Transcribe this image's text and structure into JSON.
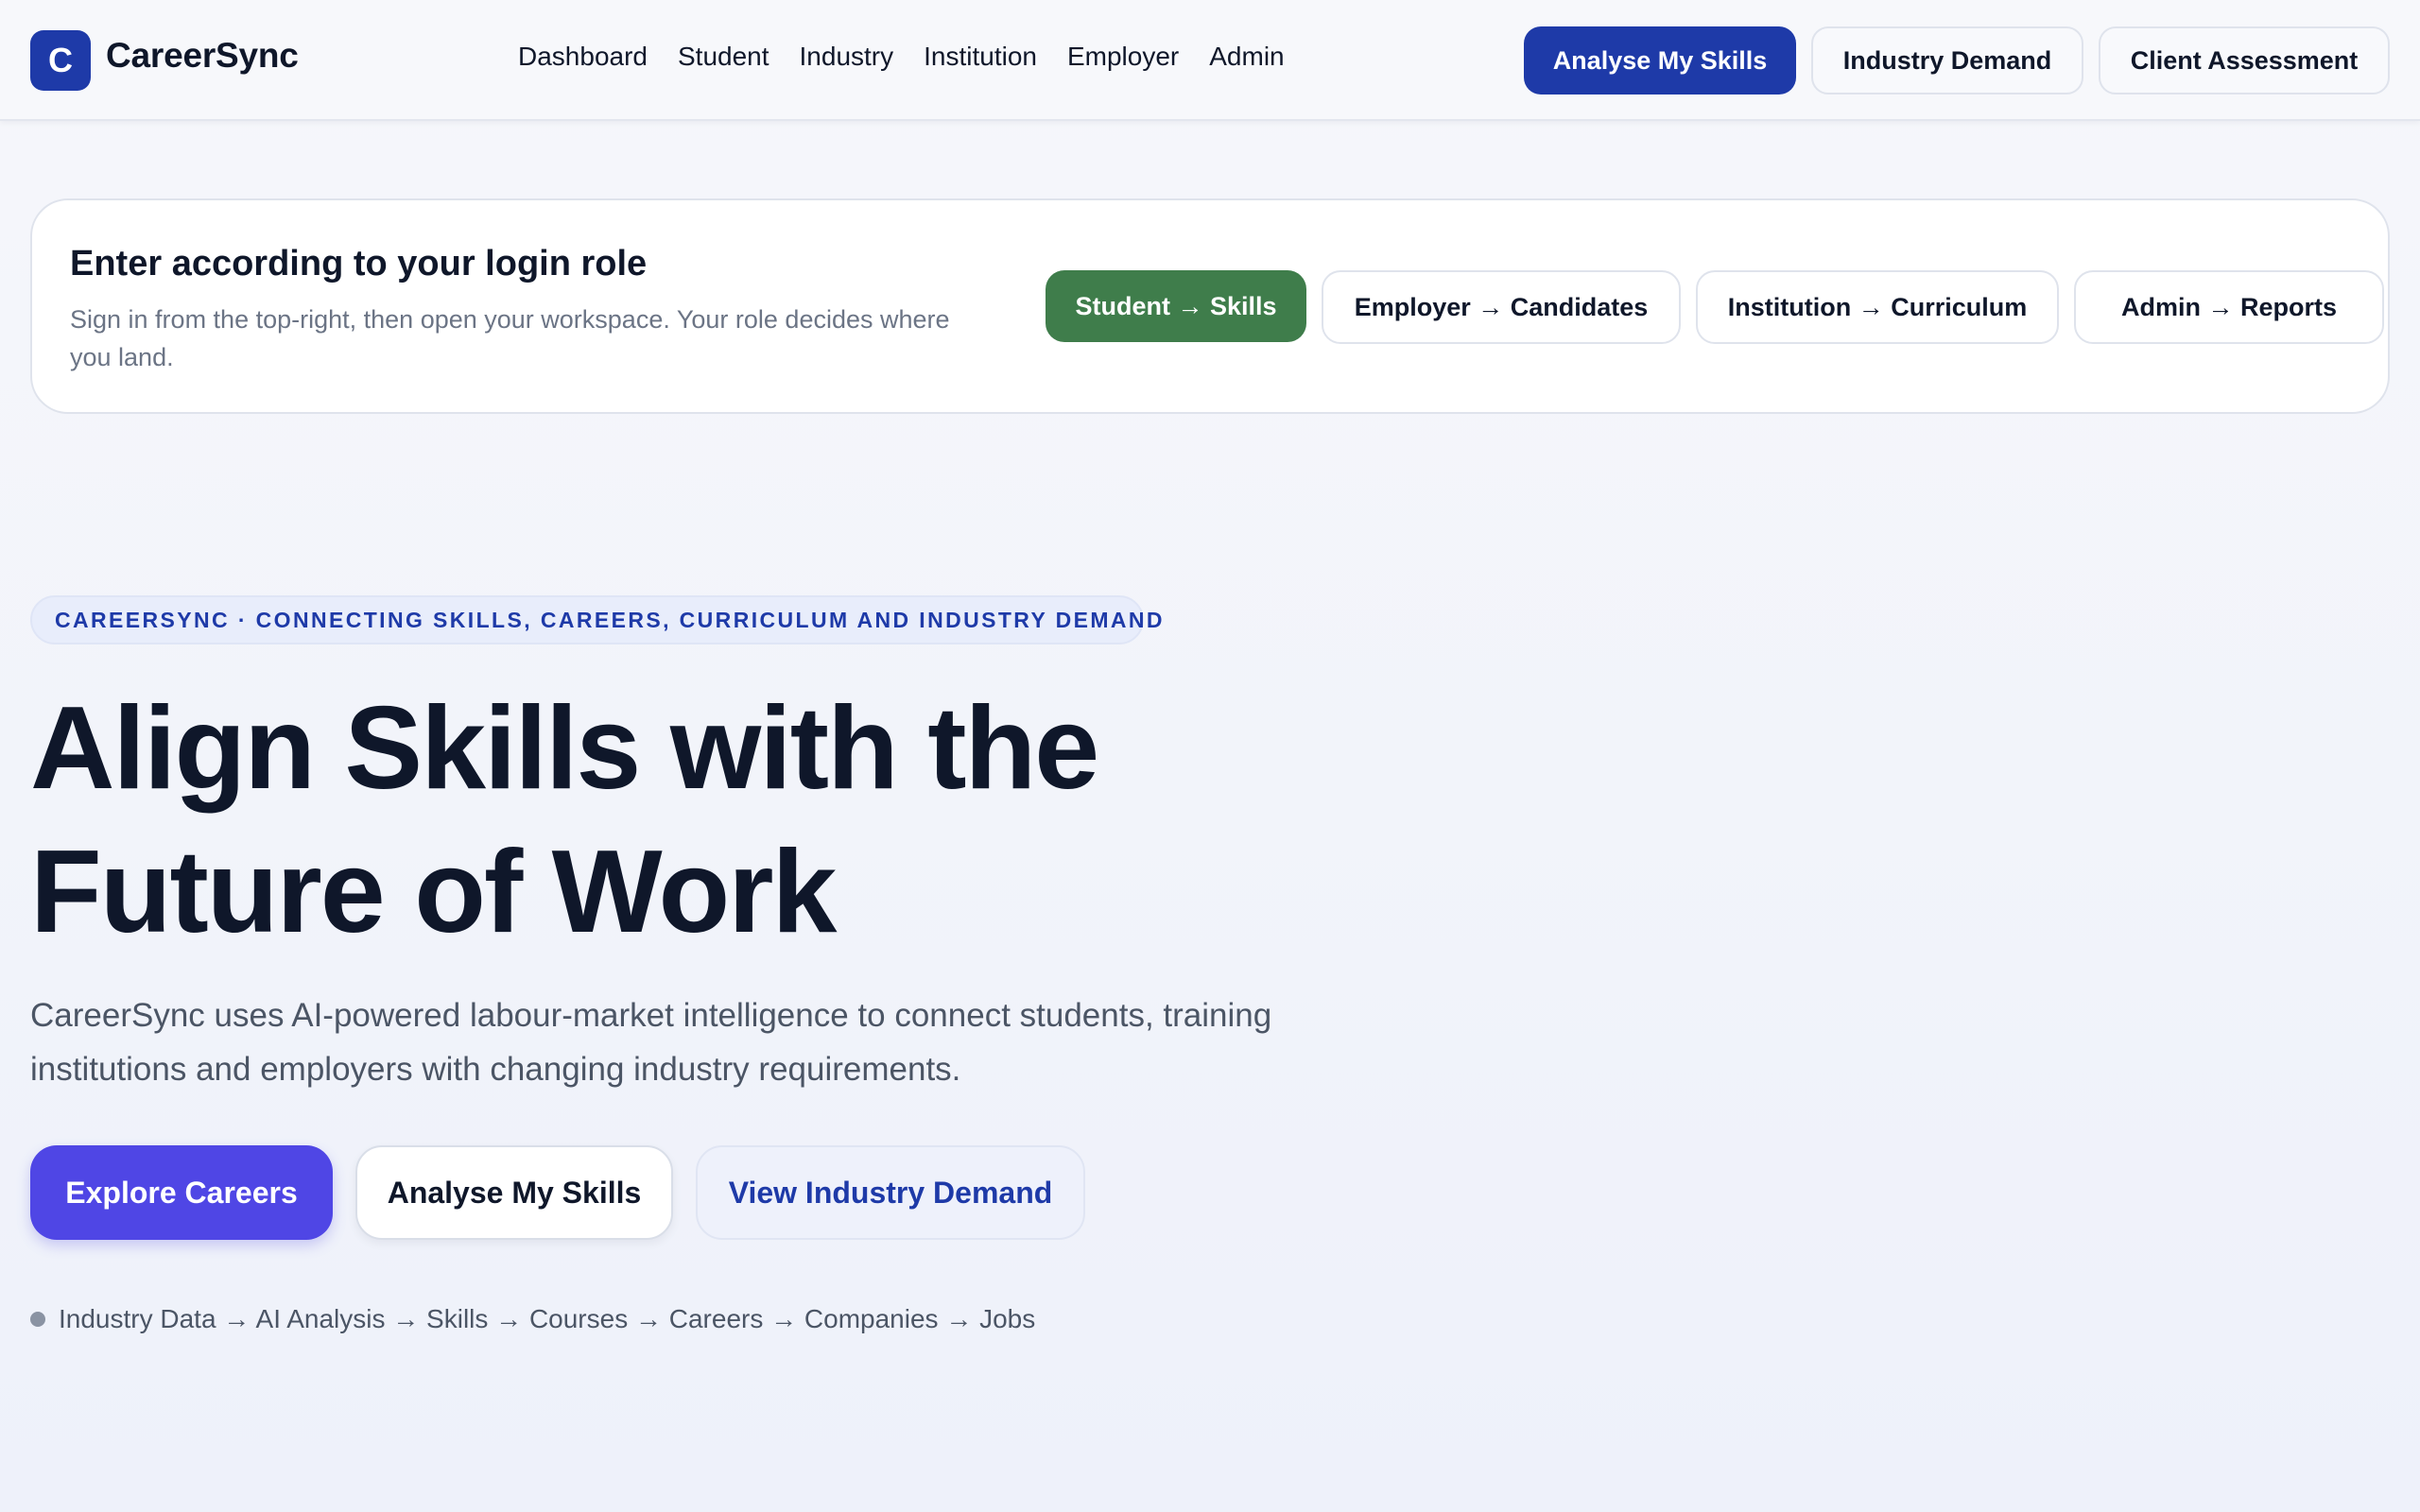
{
  "header": {
    "logo_letter": "C",
    "brand": "CareerSync",
    "nav": [
      "Dashboard",
      "Student",
      "Industry",
      "Institution",
      "Employer",
      "Admin"
    ],
    "buttons": {
      "analyse": "Analyse My Skills",
      "industry_demand": "Industry Demand",
      "client_assessment": "Client Assessment"
    }
  },
  "role_card": {
    "title": "Enter according to your login role",
    "description": "Sign in from the top-right, then open your workspace. Your role decides where you land.",
    "roles": [
      "Student → Skills",
      "Employer → Candidates",
      "Institution → Curriculum",
      "Admin → Reports"
    ]
  },
  "hero": {
    "tagline": "CAREERSYNC · CONNECTING SKILLS, CAREERS, CURRICULUM AND INDUSTRY DEMAND",
    "title_line1": "Align Skills with the",
    "title_line2": "Future of Work",
    "subtitle": "CareerSync uses AI-powered labour-market intelligence to connect students, training institutions and employers with changing industry requirements.",
    "cta": {
      "explore": "Explore Careers",
      "analyse": "Analyse My Skills",
      "view_demand": "View Industry Demand"
    },
    "flow": "Industry Data → AI Analysis → Skills → Courses → Careers → Companies → Jobs"
  },
  "colors": {
    "brand_blue": "#1e3aa8",
    "student_green": "#3f7d4b",
    "cta_indigo": "#4f46e5"
  }
}
